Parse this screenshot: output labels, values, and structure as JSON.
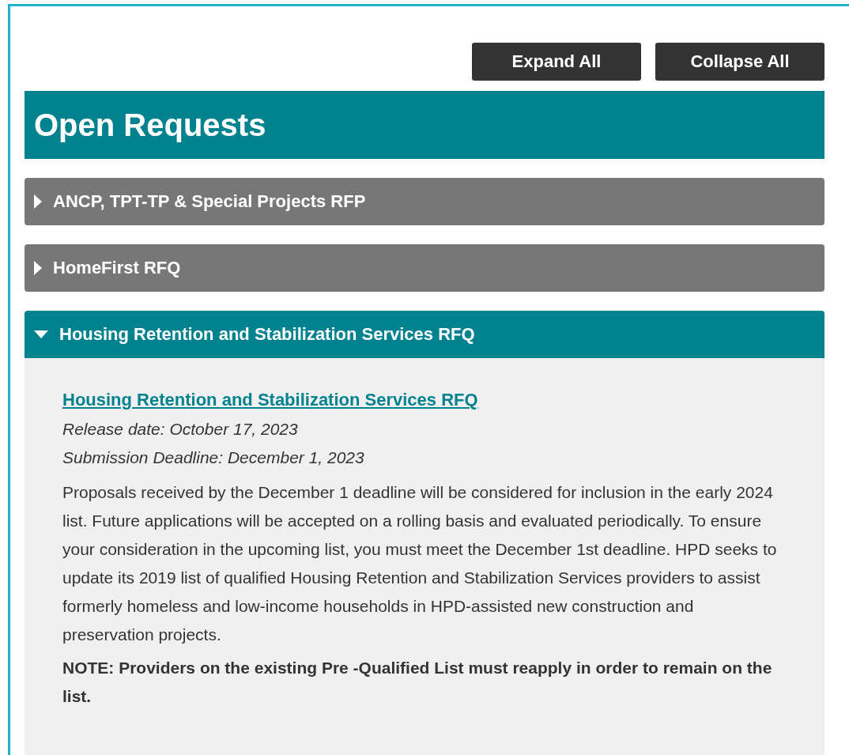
{
  "buttons": [
    {
      "label": "Expand All"
    },
    {
      "label": "Collapse All"
    }
  ],
  "section_title": "Open Requests",
  "accordion": [
    {
      "title": "ANCP, TPT-TP & Special Projects RFP",
      "expanded": false
    },
    {
      "title": "HomeFirst RFQ",
      "expanded": false
    },
    {
      "title": "Housing Retention and Stabilization Services RFQ",
      "expanded": true,
      "content": {
        "link": "Housing Retention and Stabilization Services RFQ",
        "release_date": "Release date: October 17, 2023",
        "deadline": "Submission Deadline: December 1, 2023",
        "description": "Proposals received by the December 1 deadline will be considered for inclusion in the early 2024 list. Future applications will be accepted on a rolling basis and evaluated periodically. To ensure your consideration in the upcoming list, you must meet the December 1st deadline. HPD seeks to update its 2019 list of qualified Housing Retention and Stabilization Services providers to assist formerly homeless and low-income households in HPD-assisted new construction and preservation projects.",
        "note": "NOTE: Providers on the existing Pre -Qualified List must reapply in order to remain on the list."
      }
    }
  ]
}
